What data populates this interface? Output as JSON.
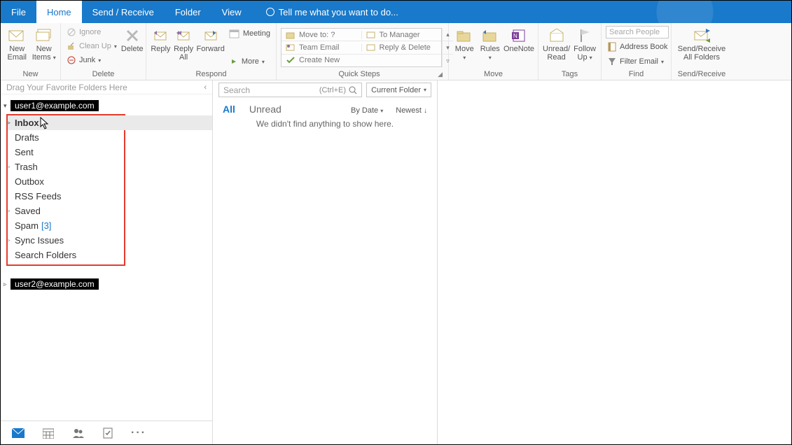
{
  "tabs": {
    "file": "File",
    "home": "Home",
    "sendreceive": "Send / Receive",
    "folder": "Folder",
    "view": "View",
    "tellme": "Tell me what you want to do..."
  },
  "ribbon": {
    "new": {
      "label": "New",
      "new_email": "New\nEmail",
      "new_items": "New\nItems"
    },
    "delete": {
      "label": "Delete",
      "ignore": "Ignore",
      "cleanup": "Clean Up",
      "junk": "Junk",
      "delete": "Delete"
    },
    "respond": {
      "label": "Respond",
      "reply": "Reply",
      "reply_all": "Reply\nAll",
      "forward": "Forward",
      "meeting": "Meeting",
      "more": "More"
    },
    "quicksteps": {
      "label": "Quick Steps",
      "moveto": "Move to: ?",
      "tomanager": "To Manager",
      "teamemail": "Team Email",
      "replydelete": "Reply & Delete",
      "createnew": "Create New"
    },
    "move": {
      "label": "Move",
      "move": "Move",
      "rules": "Rules",
      "onenote": "OneNote"
    },
    "tags": {
      "label": "Tags",
      "unreadread": "Unread/\nRead",
      "followup": "Follow\nUp"
    },
    "find": {
      "label": "Find",
      "search_people_ph": "Search People",
      "addressbook": "Address Book",
      "filteremail": "Filter Email"
    },
    "sendrecv": {
      "label": "Send/Receive",
      "btn": "Send/Receive\nAll Folders"
    }
  },
  "nav": {
    "favorites_hint": "Drag Your Favorite Folders Here",
    "account1": "user1@example.com",
    "account2": "user2@example.com",
    "folders": {
      "inbox": "Inbox",
      "drafts": "Drafts",
      "sent": "Sent",
      "trash": "Trash",
      "outbox": "Outbox",
      "rss": "RSS Feeds",
      "saved": "Saved",
      "spam": "Spam",
      "spam_count": "[3]",
      "sync": "Sync Issues",
      "search": "Search Folders"
    }
  },
  "list": {
    "search_ph": "Search",
    "search_hint": "(Ctrl+E)",
    "scope": "Current Folder",
    "all": "All",
    "unread": "Unread",
    "bydate": "By Date",
    "newest": "Newest",
    "empty": "We didn't find anything to show here."
  }
}
